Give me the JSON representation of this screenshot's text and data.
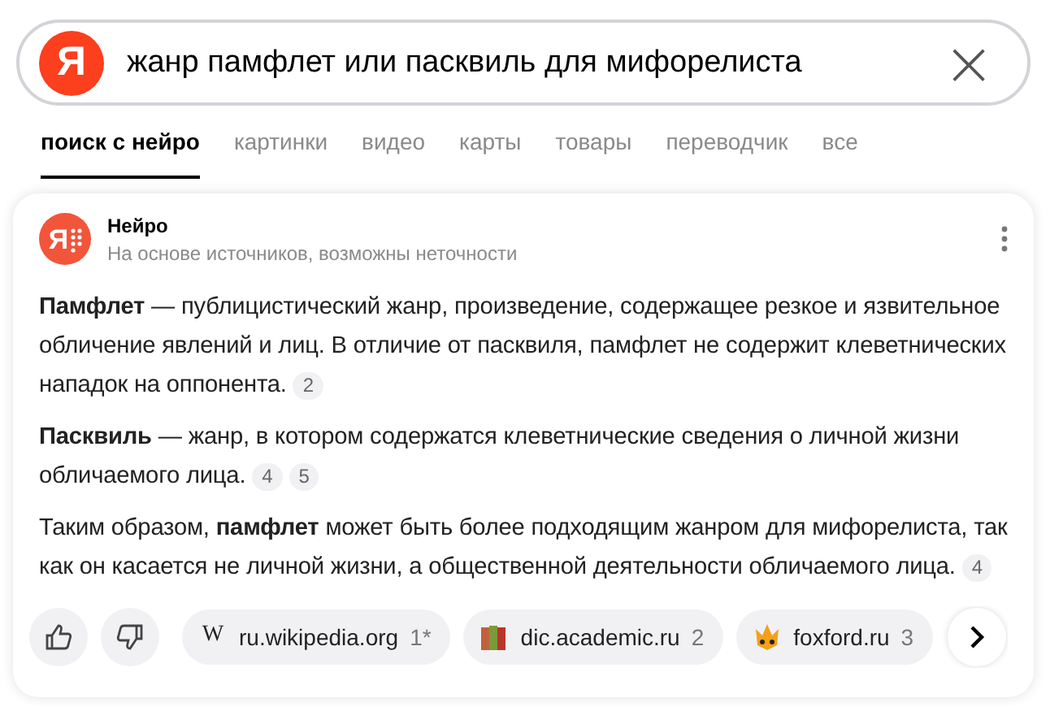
{
  "search": {
    "logo": "Я",
    "value": "жанр памфлет или пасквиль для мифорелиста",
    "clear": "×"
  },
  "tabs": [
    {
      "label": "поиск с нейро",
      "selected": true
    },
    {
      "label": "картинки",
      "selected": false
    },
    {
      "label": "видео",
      "selected": false
    },
    {
      "label": "карты",
      "selected": false
    },
    {
      "label": "товары",
      "selected": false
    },
    {
      "label": "переводчик",
      "selected": false
    },
    {
      "label": "все",
      "selected": false
    }
  ],
  "answer": {
    "icon_letter": "Я",
    "title": "Нейро",
    "subtitle": "На основе источников, возможны неточности",
    "paragraphs": [
      {
        "text": "**Памфлет** — публицистический жанр, произведение, содержащее резкое и язвительное обличение явлений и лиц. В отличие от пасквиля, памфлет не содержит клеветнических нападок на оппонента.",
        "refs": [
          "2"
        ]
      },
      {
        "text": "**Пасквиль** — жанр, в котором содержатся клеветнические сведения о личной жизни обличаемого лица.",
        "refs": [
          "4",
          "5"
        ]
      },
      {
        "text": "Таким образом, **памфлет** может быть более подходящим жанром для мифорелиста, так как он касается не личной жизни, а общественной деятельности обличаемого лица.",
        "refs": [
          "4"
        ]
      }
    ],
    "sources": [
      {
        "kind": "letter",
        "letter": "W",
        "domain": "ru.wikipedia.org",
        "ref": "1*"
      },
      {
        "kind": "books",
        "domain": "dic.academic.ru",
        "ref": "2"
      },
      {
        "kind": "fox",
        "domain": "foxford.ru",
        "ref": "3"
      }
    ]
  }
}
